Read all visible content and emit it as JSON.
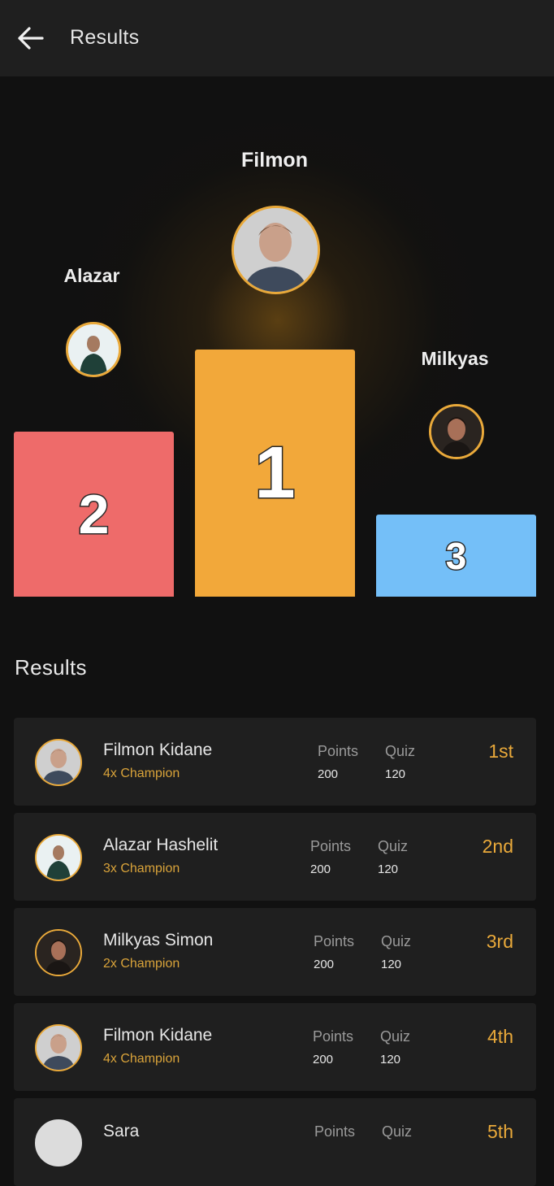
{
  "appbar": {
    "title": "Results",
    "back_icon": "arrow-left-icon"
  },
  "colors": {
    "accent": "#e9a93a",
    "first_block": "#f2a83a",
    "second_block": "#ee6b6a",
    "third_block": "#74bff8",
    "card_bg": "#1f1f1f",
    "background": "#111111"
  },
  "podium": {
    "first": {
      "name": "Filmon",
      "rank": "1"
    },
    "second": {
      "name": "Alazar",
      "rank": "2"
    },
    "third": {
      "name": "Milkyas",
      "rank": "3"
    }
  },
  "section": {
    "title": "Results"
  },
  "results": [
    {
      "name": "Filmon Kidane",
      "titles": "4x Champion",
      "points_label": "Points",
      "points": "200",
      "quiz_label": "Quiz",
      "quiz": "120",
      "rank": "1st"
    },
    {
      "name": "Alazar Hashelit",
      "titles": "3x Champion",
      "points_label": "Points",
      "points": "200",
      "quiz_label": "Quiz",
      "quiz": "120",
      "rank": "2nd"
    },
    {
      "name": "Milkyas Simon",
      "titles": "2x Champion",
      "points_label": "Points",
      "points": "200",
      "quiz_label": "Quiz",
      "quiz": "120",
      "rank": "3rd"
    },
    {
      "name": "Filmon Kidane",
      "titles": "4x Champion",
      "points_label": "Points",
      "points": "200",
      "quiz_label": "Quiz",
      "quiz": "120",
      "rank": "4th"
    },
    {
      "name": "Sara",
      "titles": "",
      "points_label": "Points",
      "points": "",
      "quiz_label": "Quiz",
      "quiz": "",
      "rank": "5th"
    }
  ]
}
